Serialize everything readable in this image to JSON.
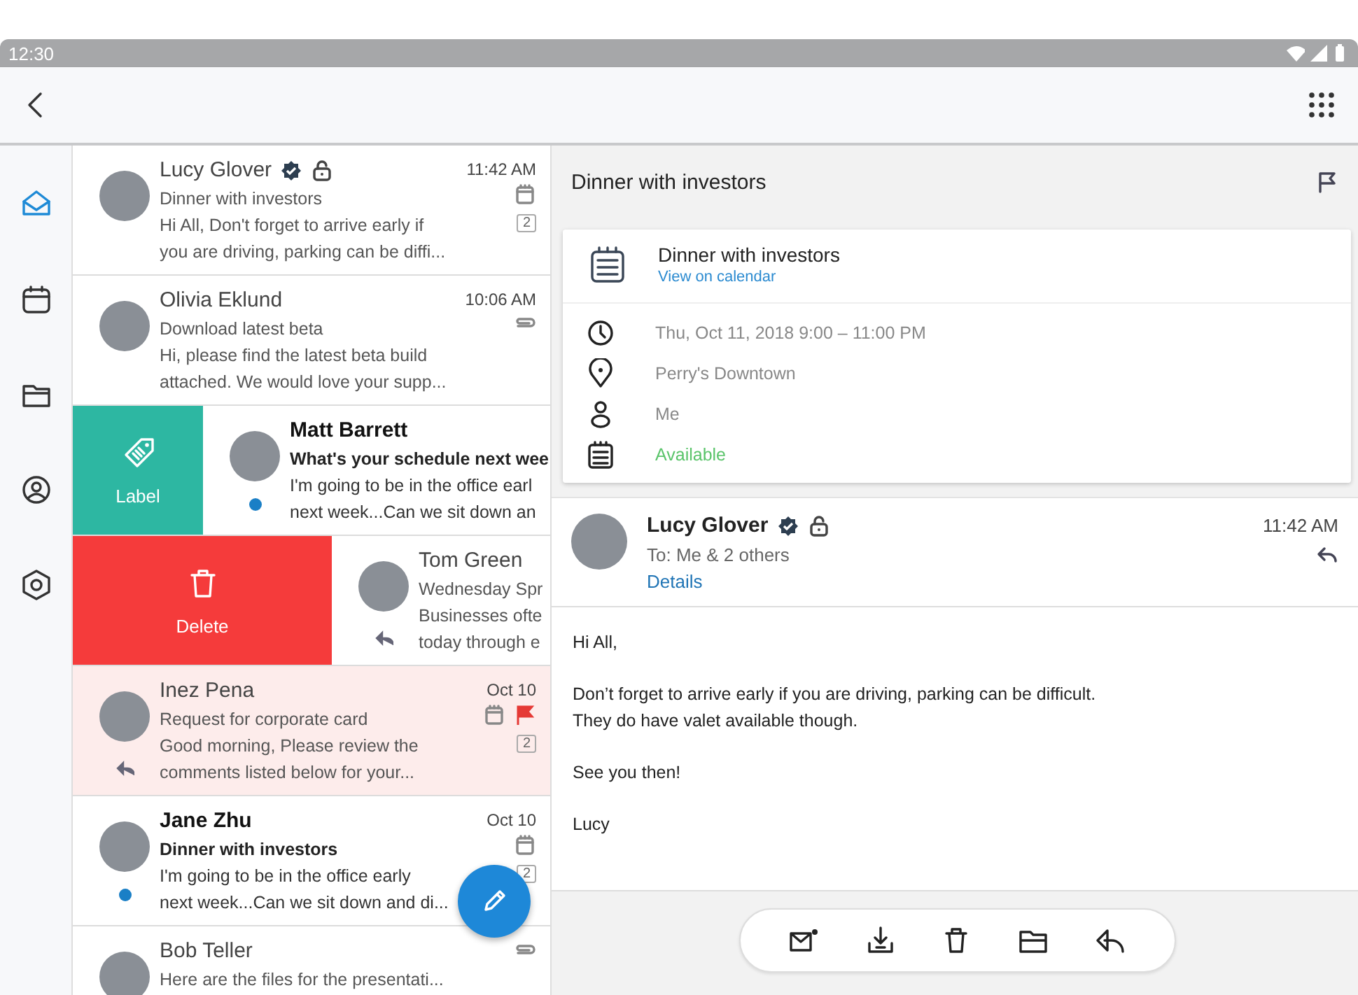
{
  "status_bar": {
    "time": "12:30"
  },
  "sidebar": {
    "items": [
      {
        "kind": "mail",
        "selected": true
      },
      {
        "kind": "calendar",
        "selected": false
      },
      {
        "kind": "folder",
        "selected": false
      },
      {
        "kind": "person",
        "selected": false
      },
      {
        "kind": "settings",
        "selected": false
      }
    ]
  },
  "messages": [
    {
      "sender": "Lucy Glover",
      "verified": true,
      "locked": true,
      "subject": "Dinner with investors",
      "preview": [
        "Hi All, Don't forget to arrive early if",
        "you are driving, parking can be diffi..."
      ],
      "time": "11:42 AM",
      "calendar": true,
      "count": "2",
      "unread": false,
      "replied": false,
      "selected": false
    },
    {
      "sender": "Olivia Eklund",
      "subject": "Download latest beta",
      "preview": [
        "Hi, please find the latest beta build",
        "attached. We would love your supp..."
      ],
      "time": "10:06 AM",
      "attachment": true,
      "unread": false,
      "replied": false,
      "selected": false
    },
    {
      "sender": "Matt Barrett",
      "subject": "What's your schedule next wee",
      "preview": [
        "I'm going to be in the office earl",
        "next week...Can we sit down an"
      ],
      "unread": true,
      "replied": false,
      "selected": false,
      "swipe": {
        "kind": "label",
        "label": "Label"
      }
    },
    {
      "sender": "Tom Green",
      "subject": "Wednesday Spr",
      "preview": [
        "Businesses ofte",
        "today through e"
      ],
      "unread": false,
      "replied": true,
      "selected": false,
      "swipe": {
        "kind": "delete",
        "label": "Delete"
      }
    },
    {
      "sender": "Inez Pena",
      "subject": "Request for corporate card",
      "preview": [
        "Good morning, Please review the",
        "comments listed below for your..."
      ],
      "time": "Oct 10",
      "calendar": true,
      "flagged": true,
      "count": "2",
      "unread": false,
      "replied": true,
      "selected": true
    },
    {
      "sender": "Jane Zhu",
      "subject": "Dinner with investors",
      "preview": [
        "I'm going to be in the office early",
        "next week...Can we sit down and di..."
      ],
      "time": "Oct 10",
      "calendar": true,
      "count": "2",
      "unread": true,
      "replied": false,
      "selected": false
    },
    {
      "sender": "Bob Teller",
      "subject": "Here are the files for the presentati...",
      "attachment": true,
      "unread": false,
      "replied": false,
      "selected": false
    }
  ],
  "detail": {
    "title": "Dinner with investors",
    "event": {
      "title": "Dinner with investors",
      "link": "View on calendar",
      "rows": [
        {
          "kind": "time",
          "text": "Thu, Oct 11, 2018 9:00 – 11:00 PM"
        },
        {
          "kind": "location",
          "text": "Perry's Downtown"
        },
        {
          "kind": "attendee",
          "text": "Me"
        },
        {
          "kind": "availability",
          "text": "Available"
        }
      ]
    },
    "message": {
      "sender": "Lucy Glover",
      "verified": true,
      "locked": true,
      "to": "To: Me & 2 others",
      "details_link": "Details",
      "time": "11:42 AM",
      "body": [
        "Hi All,",
        "Don’t forget to arrive early if you are driving, parking can be difficult.\nThey do have valet available though.",
        "See you then!",
        "Lucy"
      ]
    },
    "toolbar": [
      {
        "kind": "mark-unread"
      },
      {
        "kind": "download"
      },
      {
        "kind": "delete"
      },
      {
        "kind": "move"
      },
      {
        "kind": "reply"
      }
    ]
  }
}
